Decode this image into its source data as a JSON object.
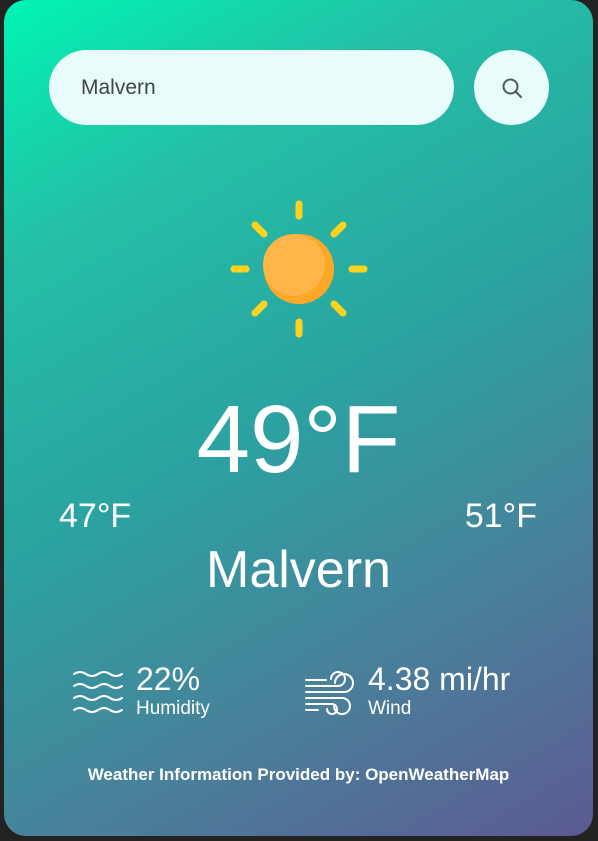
{
  "search": {
    "value": "Malvern",
    "button_icon": "search-icon"
  },
  "weather": {
    "icon": "sun-icon",
    "temperature": "49°F",
    "temp_min": "47°F",
    "temp_max": "51°F",
    "city": "Malvern"
  },
  "stats": {
    "humidity": {
      "icon": "waves-icon",
      "value": "22%",
      "label": "Humidity"
    },
    "wind": {
      "icon": "wind-icon",
      "value": "4.38 mi/hr",
      "label": "Wind"
    }
  },
  "footer": {
    "credit": "Weather Information Provided by: OpenWeatherMap"
  },
  "colors": {
    "gradient_start": "#00f5b4",
    "gradient_end": "#5c5a92",
    "sun_core": "#ffb23e",
    "sun_rays": "#ffd21f",
    "input_bg": "#e8fcfb"
  }
}
